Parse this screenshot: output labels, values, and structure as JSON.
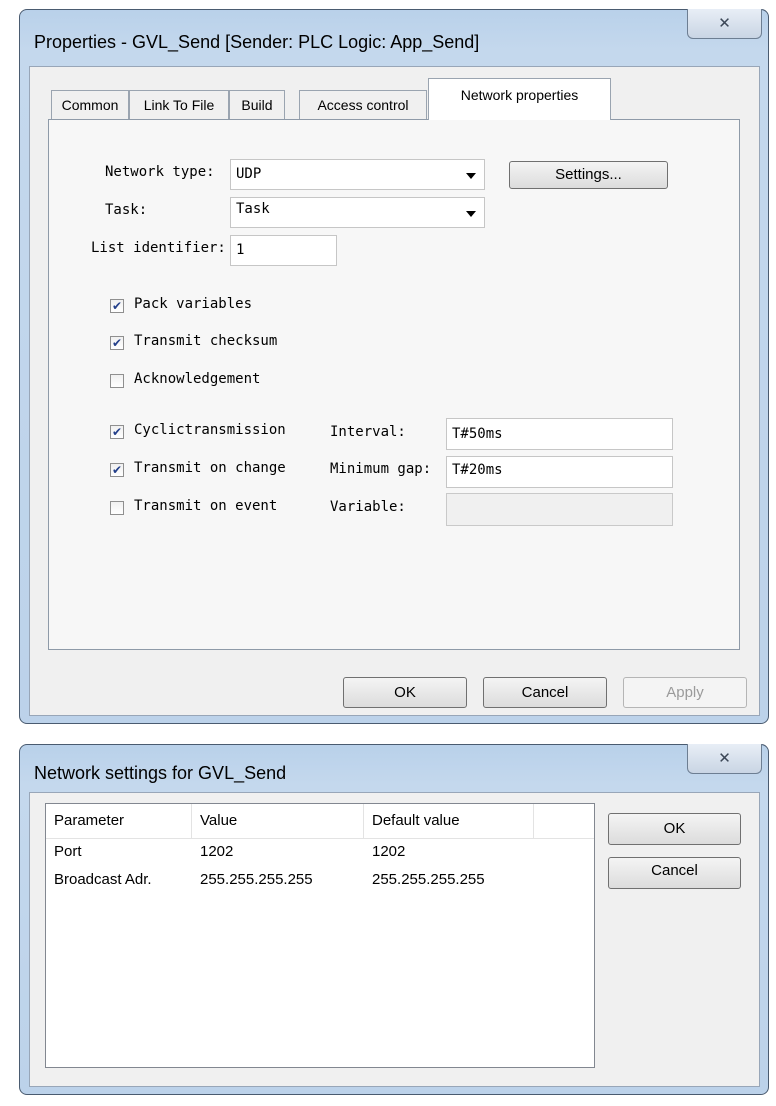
{
  "properties_dialog": {
    "title": "Properties - GVL_Send [Sender: PLC Logic: App_Send]",
    "close_glyph": "✕",
    "tabs": [
      {
        "label": "Common"
      },
      {
        "label": "Link To File"
      },
      {
        "label": "Build"
      },
      {
        "label": "Access control"
      },
      {
        "label": "Network properties",
        "active": true
      }
    ],
    "network_type": {
      "label": "Network type:",
      "value": "UDP"
    },
    "settings_button": "Settings...",
    "task": {
      "label": "Task:",
      "value": "Task"
    },
    "list_identifier": {
      "label": "List identifier:",
      "value": "1"
    },
    "checkboxes": [
      {
        "label": "Pack variables",
        "checked": true
      },
      {
        "label": "Transmit checksum",
        "checked": true
      },
      {
        "label": "Acknowledgement",
        "checked": false
      },
      {
        "label": "Cyclictransmission",
        "checked": true
      },
      {
        "label": "Transmit on change",
        "checked": true
      },
      {
        "label": "Transmit on event",
        "checked": false
      }
    ],
    "interval": {
      "label": "Interval:",
      "value": "T#50ms"
    },
    "minimum_gap": {
      "label": "Minimum gap:",
      "value": "T#20ms"
    },
    "variable": {
      "label": "Variable:",
      "value": ""
    },
    "buttons": {
      "ok": "OK",
      "cancel": "Cancel",
      "apply": "Apply"
    }
  },
  "network_settings_dialog": {
    "title": "Network settings for GVL_Send",
    "close_glyph": "✕",
    "columns": [
      "Parameter",
      "Value",
      "Default value"
    ],
    "rows": [
      {
        "parameter": "Port",
        "value": "1202",
        "default": "1202"
      },
      {
        "parameter": "Broadcast Adr.",
        "value": "255.255.255.255",
        "default": "255.255.255.255"
      }
    ],
    "buttons": {
      "ok": "OK",
      "cancel": "Cancel"
    }
  },
  "colors": {
    "window_frame": "#b9d1ea",
    "client_background": "#f0f0f0",
    "check_mark": "#233f8a"
  }
}
